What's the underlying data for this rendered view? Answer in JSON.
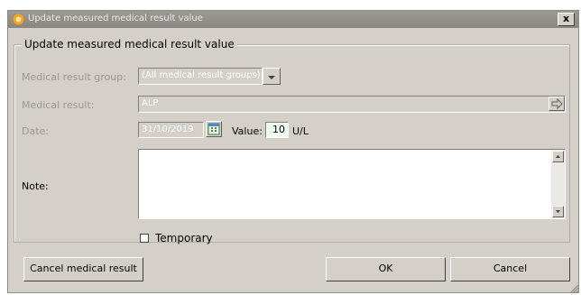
{
  "window": {
    "title": "Update measured medical result value",
    "close_label": "x"
  },
  "group": {
    "legend": "Update measured medical result value"
  },
  "form": {
    "group_label": "Medical result group:",
    "group_value": "(All medical result groups)",
    "result_label": "Medical result:",
    "result_value": "ALP",
    "date_label": "Date:",
    "date_value": "31/10/2019",
    "value_label": "Value:",
    "value_value": "10",
    "unit": "U/L",
    "note_label": "Note:",
    "note_value": "",
    "temporary_label": "Temporary",
    "temporary_checked": false
  },
  "buttons": {
    "cancel_result": "Cancel medical result",
    "ok": "OK",
    "cancel": "Cancel"
  },
  "icons": {
    "app": "app-sun-icon",
    "dropdown": "chevron-down-icon",
    "navigate": "arrow-right-icon",
    "calendar": "calendar-icon",
    "scroll_up": "arrow-up-icon",
    "scroll_down": "arrow-down-icon"
  },
  "colors": {
    "window_bg": "#d4d0c8",
    "titlebar": "#8a8782",
    "value_bg": "#f0fff0"
  }
}
